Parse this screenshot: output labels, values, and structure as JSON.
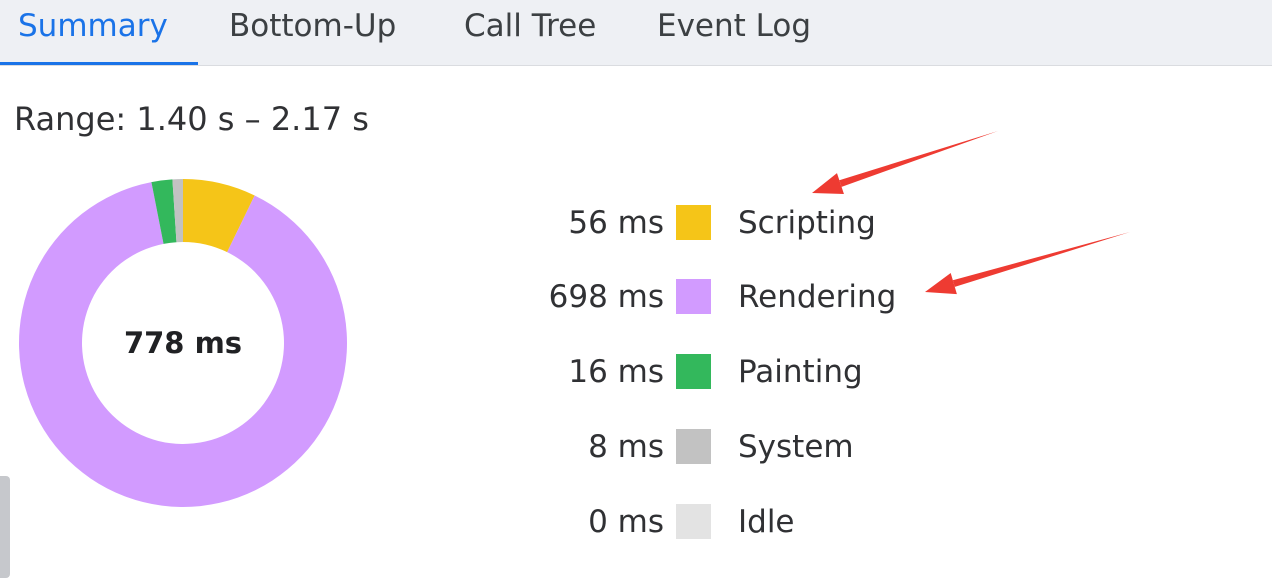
{
  "tabs": [
    {
      "label": "Summary",
      "active": true
    },
    {
      "label": "Bottom-Up",
      "active": false
    },
    {
      "label": "Call Tree",
      "active": false
    },
    {
      "label": "Event Log",
      "active": false
    }
  ],
  "range": "Range: 1.40 s – 2.17 s",
  "donut": {
    "total_label": "778 ms"
  },
  "chart_data": {
    "type": "pie",
    "categories": [
      "Scripting",
      "Rendering",
      "Painting",
      "System",
      "Idle"
    ],
    "values": [
      56,
      698,
      16,
      8,
      0
    ],
    "value_labels": [
      "56 ms",
      "698 ms",
      "16 ms",
      "8 ms",
      "0 ms"
    ],
    "colors": [
      "#f5c518",
      "#d29bff",
      "#33b85c",
      "#c2c2c2",
      "#e3e3e3"
    ]
  },
  "annotations": {
    "arrow_color": "#ee3b32",
    "arrow_targets": [
      "Scripting",
      "Rendering"
    ]
  }
}
